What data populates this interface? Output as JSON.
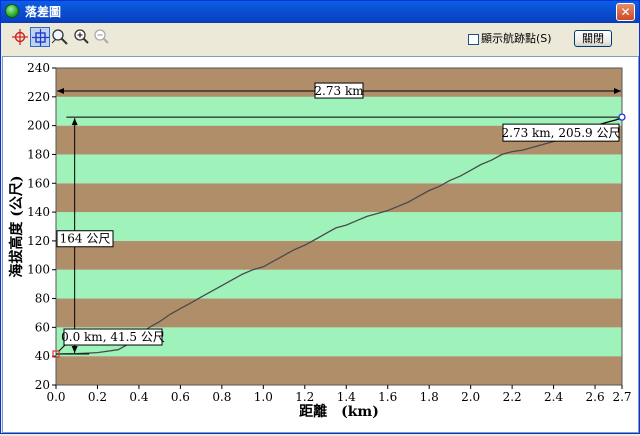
{
  "window": {
    "title": "落差圖",
    "close_glyph": "✕"
  },
  "toolbar": {
    "tools": [
      {
        "name": "crosshair-red-tool",
        "icon": "crosshair-red-icon"
      },
      {
        "name": "crosshair-blue-tool",
        "icon": "crosshair-blue-icon",
        "active": true
      },
      {
        "name": "pan-zoom-tool",
        "icon": "magnifier-hand-icon"
      },
      {
        "name": "zoom-in-tool",
        "icon": "zoom-in-icon"
      },
      {
        "name": "zoom-out-tool",
        "icon": "zoom-out-icon",
        "disabled": true
      }
    ],
    "show_track_points_label": "顯示航跡點(S)",
    "show_track_points_checked": false,
    "close_button_label": "關閉"
  },
  "chart_data": {
    "type": "area",
    "xlabel": "距離　(km)",
    "ylabel": "海拔高度 (公尺)",
    "xlim": [
      0,
      2.73
    ],
    "ylim": [
      20,
      240
    ],
    "x_ticks": [
      "0.0",
      "0.2",
      "0.4",
      "0.6",
      "0.8",
      "1.0",
      "1.2",
      "1.4",
      "1.6",
      "1.8",
      "2.0",
      "2.2",
      "2.4",
      "2.6",
      "2.7"
    ],
    "x_tick_values": [
      0,
      0.2,
      0.4,
      0.6,
      0.8,
      1.0,
      1.2,
      1.4,
      1.6,
      1.8,
      2.0,
      2.2,
      2.4,
      2.6,
      2.73
    ],
    "y_ticks": [
      "20",
      "40",
      "60",
      "80",
      "100",
      "120",
      "140",
      "160",
      "180",
      "200",
      "220",
      "240"
    ],
    "y_tick_values": [
      20,
      40,
      60,
      80,
      100,
      120,
      140,
      160,
      180,
      200,
      220,
      240
    ],
    "band_size": 20,
    "profile": {
      "x": [
        0,
        0.1,
        0.2,
        0.3,
        0.35,
        0.4,
        0.45,
        0.5,
        0.55,
        0.6,
        0.65,
        0.7,
        0.75,
        0.8,
        0.85,
        0.9,
        0.95,
        1.0,
        1.05,
        1.1,
        1.15,
        1.2,
        1.25,
        1.3,
        1.35,
        1.4,
        1.45,
        1.5,
        1.55,
        1.6,
        1.65,
        1.7,
        1.75,
        1.8,
        1.85,
        1.9,
        1.95,
        2.0,
        2.05,
        2.1,
        2.15,
        2.2,
        2.25,
        2.3,
        2.35,
        2.4,
        2.45,
        2.5,
        2.55,
        2.6,
        2.65,
        2.7,
        2.73
      ],
      "y": [
        41.5,
        41.8,
        42.5,
        44.5,
        48.5,
        55,
        60,
        64,
        69,
        73,
        77,
        81,
        85,
        89,
        93,
        97,
        100,
        102,
        106,
        110,
        114,
        117,
        121,
        125,
        129,
        131,
        134,
        137,
        139,
        141,
        144,
        147,
        151,
        155,
        158,
        162,
        165,
        169,
        173,
        176,
        180,
        182,
        183,
        185,
        187,
        189,
        191,
        194,
        196,
        199,
        202,
        204,
        205.9
      ]
    },
    "total_distance_label": "2.73 km",
    "elevation_gain_label": "164 公尺",
    "start_point": {
      "x": 0,
      "y": 41.5,
      "label": "0.0 km, 41.5 公尺"
    },
    "end_point": {
      "x": 2.73,
      "y": 205.9,
      "label": "2.73 km, 205.9 公尺"
    },
    "colors": {
      "sky": "#d9fefe",
      "band_dark": "#b18e6a",
      "band_light": "#9ef2ba",
      "line": "#4a4a4a",
      "start_marker": "#e03030",
      "end_marker": "#2030e0"
    }
  }
}
